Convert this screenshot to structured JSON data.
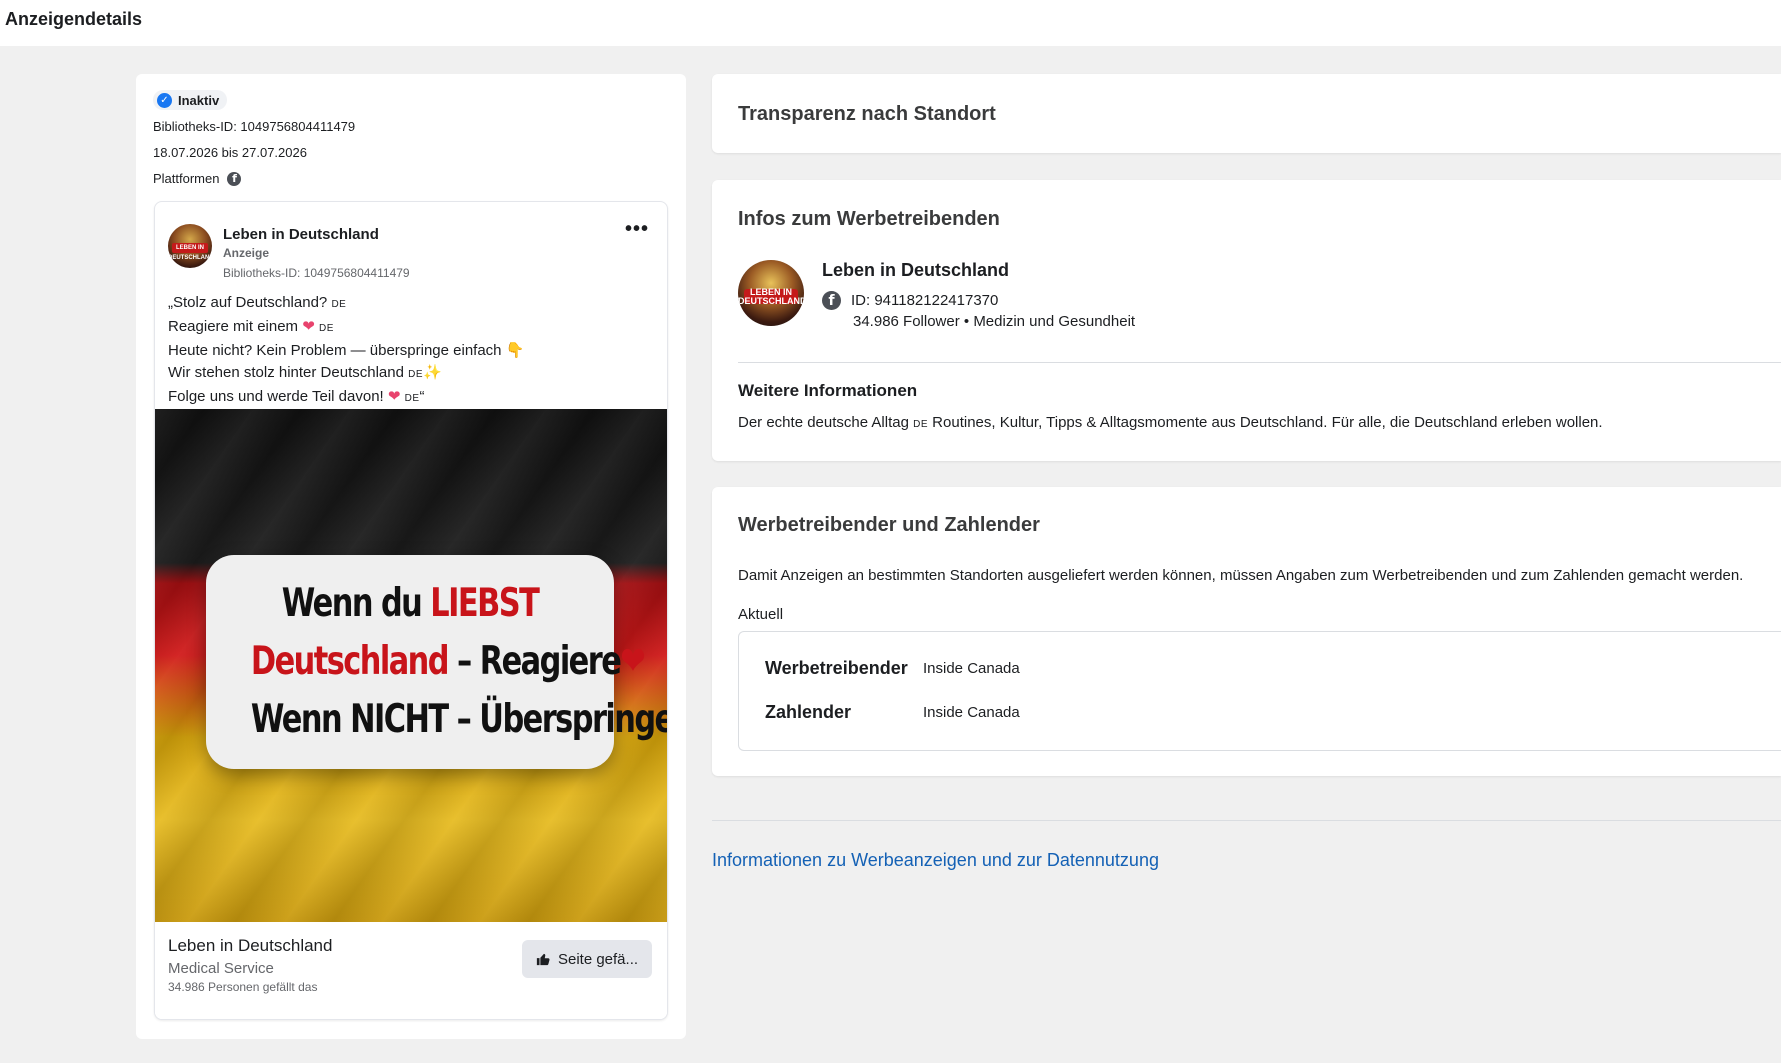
{
  "header": {
    "title": "Anzeigendetails"
  },
  "ad": {
    "status": "Inaktiv",
    "library_id": "Bibliotheks-ID: 1049756804411479",
    "date_range": "18.07.2026 bis 27.07.2026",
    "platforms_label": "Plattformen"
  },
  "post": {
    "page_name": "Leben in Deutschland",
    "sponsored_label": "Anzeige",
    "library_id": "Bibliotheks-ID: 1049756804411479",
    "avatar_text": "LEBEN IN DEUTSCHLAND",
    "menu_glyph": "•••",
    "text": {
      "line1": "„Stolz auf Deutschland? ",
      "line2": "Reagiere mit einem ",
      "line3": "Heute nicht? Kein Problem — überspringe einfach ",
      "line4": "Wir stehen stolz hinter Deutschland ",
      "line5": "Folge uns und werde Teil davon! ",
      "line5_end": "“",
      "flag_tag": "DE",
      "heart": "❤",
      "thumbs_down": "👇",
      "sparkles": "✨"
    },
    "image_text": {
      "line1_a": "Wenn du ",
      "line1_b": "LIEBST",
      "line2_a": "Deutschland",
      "line2_b": " – Reagiere",
      "line2_heart": "❤",
      "line3": "Wenn NICHT – Überspringe",
      "line3_icon": "👎"
    },
    "footer": {
      "name": "Leben in Deutschland",
      "category": "Medical Service",
      "likes": "34.986 Personen gefällt das",
      "like_button": "Seite gefä..."
    }
  },
  "transparency": {
    "title": "Transparenz nach Standort"
  },
  "advertiser_info": {
    "title": "Infos zum Werbetreibenden",
    "name": "Leben in Deutschland",
    "avatar_text": "LEBEN IN DEUTSCHLAND",
    "id": "ID: 941182122417370",
    "followers": "34.986 Follower • Medizin und Gesundheit",
    "more_title": "Weitere Informationen",
    "more_text_a": "Der echte deutsche Alltag ",
    "more_text_flag": "DE",
    "more_text_b": " Routines, Kultur, Tipps & Alltagsmomente aus Deutschland. Für alle, die Deutschland erleben wollen."
  },
  "payer": {
    "title": "Werbetreibender und Zahlender",
    "description": "Damit Anzeigen an bestimmten Standorten ausgeliefert werden können, müssen Angaben zum Werbetreibenden und zum Zahlenden gemacht werden.",
    "current_label": "Aktuell",
    "rows": [
      {
        "key": "Werbetreibender",
        "value": "Inside Canada"
      },
      {
        "key": "Zahlender",
        "value": "Inside Canada"
      }
    ]
  },
  "footer_link": "Informationen zu Werbeanzeigen und zur Datennutzung",
  "colors": {
    "accent": "#1877f2",
    "link": "#1461b5",
    "flag_black": "#111111",
    "flag_red": "#d11a1a",
    "flag_gold": "#e7bc22"
  },
  "icons": {
    "status": "check-circle-icon",
    "platform": "facebook-icon",
    "like": "thumbs-up-icon"
  }
}
